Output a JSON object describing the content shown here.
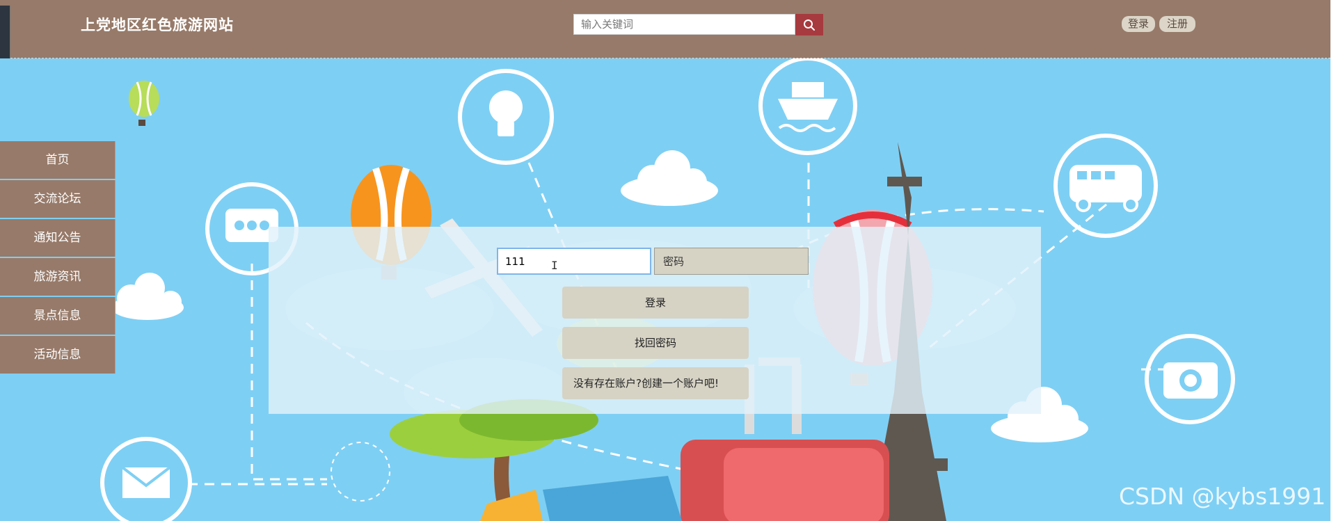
{
  "header": {
    "site_title": "上党地区红色旅游网站",
    "search_placeholder": "输入关键词",
    "login_label": "登录",
    "register_label": "注册"
  },
  "sidenav": {
    "items": [
      {
        "label": "首页"
      },
      {
        "label": "交流论坛"
      },
      {
        "label": "通知公告"
      },
      {
        "label": "旅游资讯"
      },
      {
        "label": "景点信息"
      },
      {
        "label": "活动信息"
      }
    ]
  },
  "login_form": {
    "username_value": "111",
    "password_placeholder": "密码",
    "login_button": "登录",
    "forgot_button": "找回密码",
    "register_link": "没有存在账户?创建一个账户吧!"
  },
  "watermark": "CSDN @kybs1991",
  "colors": {
    "header_bg": "#977a69",
    "hero_bg": "#7ecff4",
    "search_button": "#a73a3f",
    "button_bg": "#d6d3c5"
  },
  "icons": [
    "search-icon",
    "bulb-icon",
    "ship-icon",
    "bus-icon",
    "chat-icon",
    "camera-icon",
    "mail-icon"
  ]
}
